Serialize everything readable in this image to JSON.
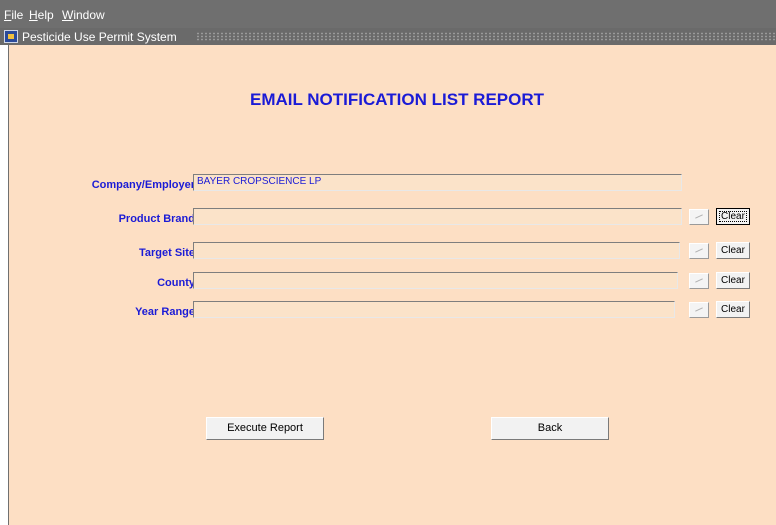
{
  "menu": {
    "file": {
      "mnemonic": "F",
      "rest": "ile"
    },
    "help": {
      "mnemonic": "H",
      "rest": "elp"
    },
    "window": {
      "mnemonic": "W",
      "rest": "indow"
    }
  },
  "window": {
    "title": "Pesticide Use Permit System",
    "icon": "app-window-icon"
  },
  "report": {
    "title": "EMAIL NOTIFICATION LIST REPORT"
  },
  "form": {
    "company": {
      "label": "Company/Employer",
      "value": "BAYER CROPSCIENCE LP"
    },
    "product_brand": {
      "label": "Product Brand",
      "value": "",
      "clear_label": "Clear"
    },
    "target_site": {
      "label": "Target Site",
      "value": "",
      "clear_label": "Clear"
    },
    "county": {
      "label": "County",
      "value": "",
      "clear_label": "Clear"
    },
    "year_range": {
      "label": "Year Range",
      "value": "",
      "clear_label": "Clear"
    }
  },
  "buttons": {
    "execute": "Execute Report",
    "back": "Back"
  },
  "colors": {
    "background": "#fddfc4",
    "label": "#1b1bd6",
    "menubar": "#6f6f6f"
  }
}
